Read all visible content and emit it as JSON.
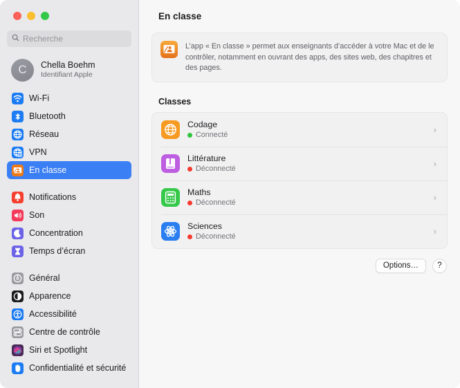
{
  "window": {
    "traffic_lights": [
      {
        "name": "close-button",
        "color": "#fa6158"
      },
      {
        "name": "minimize-button",
        "color": "#fbbe2f"
      },
      {
        "name": "zoom-button",
        "color": "#33c848"
      }
    ]
  },
  "search": {
    "placeholder": "Recherche",
    "value": ""
  },
  "account": {
    "avatar_initial": "C",
    "name": "Chella Boehm",
    "subtitle": "Identifiant Apple"
  },
  "sidebar": {
    "groups": [
      {
        "items": [
          {
            "label": "Wi-Fi",
            "icon": "wifi-icon",
            "icon_bg": "#1d7cf3",
            "selected": false
          },
          {
            "label": "Bluetooth",
            "icon": "bluetooth-icon",
            "icon_bg": "#1d7cf3",
            "selected": false
          },
          {
            "label": "Réseau",
            "icon": "network-globe-icon",
            "icon_bg": "#1d7cf3",
            "selected": false
          },
          {
            "label": "VPN",
            "icon": "vpn-globe-icon",
            "icon_bg": "#1d7cf3",
            "selected": false
          },
          {
            "label": "En classe",
            "icon": "classroom-icon",
            "icon_bg": "#ee7a17",
            "selected": true
          }
        ]
      },
      {
        "items": [
          {
            "label": "Notifications",
            "icon": "bell-icon",
            "icon_bg": "#f5402f",
            "selected": false
          },
          {
            "label": "Son",
            "icon": "speaker-icon",
            "icon_bg": "#f33a5a",
            "selected": false
          },
          {
            "label": "Concentration",
            "icon": "moon-icon",
            "icon_bg": "#6c63e8",
            "selected": false
          },
          {
            "label": "Temps d’écran",
            "icon": "hourglass-icon",
            "icon_bg": "#6c63e8",
            "selected": false
          }
        ]
      },
      {
        "items": [
          {
            "label": "Général",
            "icon": "gear-icon",
            "icon_bg": "#9b9ba0",
            "selected": false
          },
          {
            "label": "Apparence",
            "icon": "appearance-icon",
            "icon_bg": "#1b1b1d",
            "selected": false
          },
          {
            "label": "Accessibilité",
            "icon": "accessibility-icon",
            "icon_bg": "#1d7cf3",
            "selected": false
          },
          {
            "label": "Centre de contrôle",
            "icon": "control-center-icon",
            "icon_bg": "#9b9ba0",
            "selected": false
          },
          {
            "label": "Siri et Spotlight",
            "icon": "siri-icon",
            "icon_bg": "#4b2a55",
            "selected": false
          },
          {
            "label": "Confidentialité et sécurité",
            "icon": "hand-icon",
            "icon_bg": "#1d7cf3",
            "selected": false
          }
        ]
      }
    ]
  },
  "main": {
    "title": "En classe",
    "banner": {
      "icon": "classroom-icon",
      "text": "L’app « En classe » permet aux enseignants d’accéder à votre Mac et de le contrôler, notamment en ouvrant des apps, des sites web, des chapitres et des pages."
    },
    "classes_heading": "Classes",
    "classes": [
      {
        "name": "Codage",
        "status": "Connecté",
        "status_color": "#2fc53f",
        "icon": "globe-icon",
        "icon_bg": "#f79a21"
      },
      {
        "name": "Littérature",
        "status": "Déconnecté",
        "status_color": "#f53b2f",
        "icon": "book-icon",
        "icon_bg": "#bd5fe0"
      },
      {
        "name": "Maths",
        "status": "Déconnecté",
        "status_color": "#f53b2f",
        "icon": "calculator-icon",
        "icon_bg": "#35c94a"
      },
      {
        "name": "Sciences",
        "status": "Déconnecté",
        "status_color": "#f53b2f",
        "icon": "atom-icon",
        "icon_bg": "#2a7ef0"
      }
    ],
    "chevron_glyph": "›",
    "options_label": "Options…",
    "help_label": "?"
  }
}
